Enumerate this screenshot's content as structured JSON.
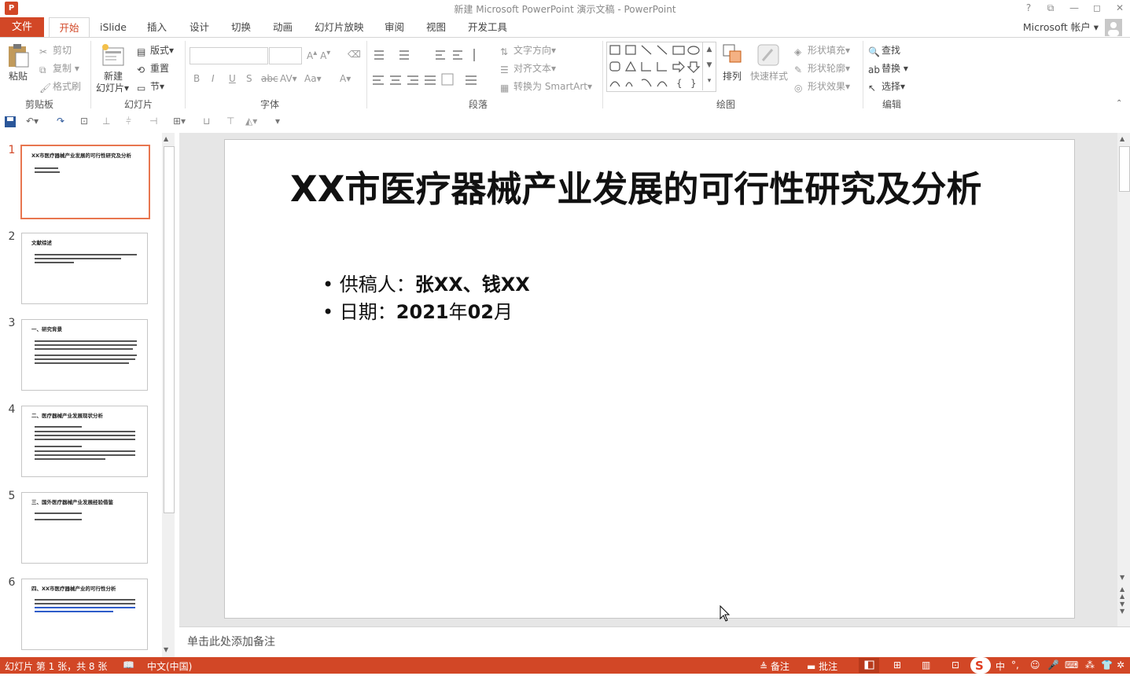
{
  "window": {
    "title": "新建 Microsoft PowerPoint 演示文稿 - PowerPoint",
    "app_icon": "P",
    "buttons": [
      "?",
      "⧉",
      "—",
      "◻",
      "✕"
    ]
  },
  "tabs": {
    "file": "文件",
    "items": [
      "开始",
      "iSlide",
      "插入",
      "设计",
      "切换",
      "动画",
      "幻灯片放映",
      "审阅",
      "视图",
      "开发工具"
    ],
    "account": "Microsoft 帐户 ▾"
  },
  "ribbon": {
    "clipboard": {
      "label": "剪贴板",
      "paste": "粘贴",
      "cut": "剪切",
      "copy": "复制",
      "format_painter": "格式刷"
    },
    "slides": {
      "label": "幻灯片",
      "new_slide_1": "新建",
      "new_slide_2": "幻灯片▾",
      "layout": "版式▾",
      "reset": "重置",
      "section": "节▾"
    },
    "font": {
      "label": "字体",
      "buttons": [
        "B",
        "I",
        "U",
        "S",
        "abc",
        "AV▾",
        "Aa▾",
        "A▾"
      ]
    },
    "paragraph": {
      "label": "段落",
      "text_direction": "文字方向▾",
      "align_text": "对齐文本▾",
      "smartart": "转换为 SmartArt▾"
    },
    "drawing": {
      "label": "绘图",
      "arrange": "排列",
      "quick_styles": "快速样式",
      "shape_fill": "形状填充▾",
      "shape_outline": "形状轮廓▾",
      "shape_effects": "形状效果▾"
    },
    "editing": {
      "label": "编辑",
      "find": "查找",
      "replace": "替换 ▾",
      "select": "选择▾"
    }
  },
  "thumbnails": [
    {
      "num": "1",
      "title": "XX市医疗器械产业发展的可行性研究及分析",
      "lines": 2
    },
    {
      "num": "2",
      "title": "文献综述",
      "lines": 3
    },
    {
      "num": "3",
      "title": "一、研究背景",
      "lines": 5
    },
    {
      "num": "4",
      "title": "二、医疗器械产业发展现状分析",
      "lines": 6
    },
    {
      "num": "5",
      "title": "三、国外医疗器械产业发展经验借鉴",
      "lines": 2
    },
    {
      "num": "6",
      "title": "四、XX市医疗器械产业的可行性分析",
      "lines": 4
    }
  ],
  "slide": {
    "title": "XX市医疗器械产业发展的可行性研究及分析",
    "bullet1_label": "供稿人：",
    "bullet1_value": "张XX、钱XX",
    "bullet2_label": "日期：",
    "bullet2_year": "2021",
    "bullet2_mid": "年",
    "bullet2_month": "02",
    "bullet2_end": "月"
  },
  "notes": {
    "placeholder": "单击此处添加备注"
  },
  "status": {
    "slide_info": "幻灯片 第 1 张，共 8 张",
    "language": "中文(中国)",
    "notes_btn": "备注",
    "comments_btn": "批注",
    "ime": "中"
  },
  "colors": {
    "accent": "#d24726",
    "selection": "#e8764f"
  }
}
